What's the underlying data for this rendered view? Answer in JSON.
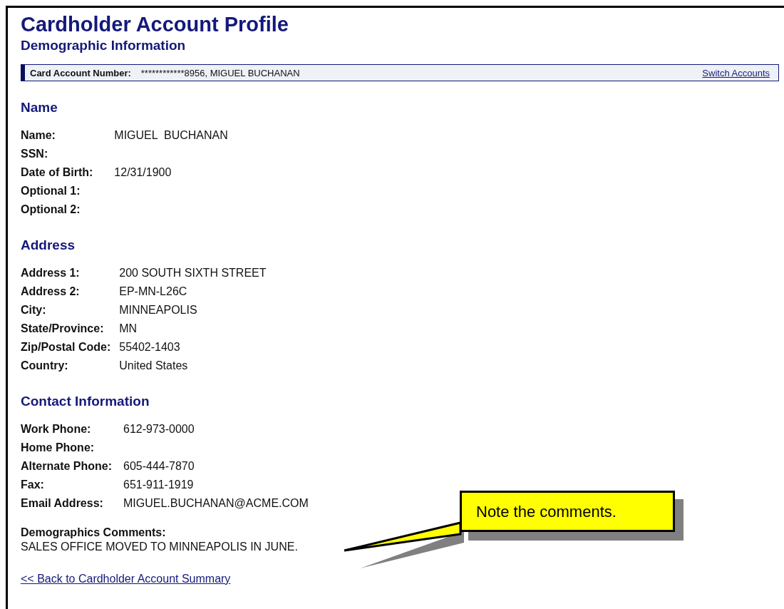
{
  "title": "Cardholder Account Profile",
  "subtitle": "Demographic Information",
  "account_bar": {
    "label": "Card Account Number:",
    "value": "************8956, MIGUEL BUCHANAN",
    "link": "Switch Accounts"
  },
  "sections": [
    {
      "heading": "Name",
      "fields": [
        {
          "label": "Name:",
          "value": "MIGUEL  BUCHANAN"
        },
        {
          "label": "SSN:"
        },
        {
          "label": "Date of Birth:",
          "value": "12/31/1900"
        },
        {
          "label": "Optional 1:"
        },
        {
          "label": "Optional 2:"
        }
      ]
    },
    {
      "heading": "Address",
      "fields": [
        {
          "label": "Address 1:",
          "value": "200 SOUTH SIXTH STREET"
        },
        {
          "label": "Address 2:",
          "value": "EP-MN-L26C"
        },
        {
          "label": "City:",
          "value": "MINNEAPOLIS"
        },
        {
          "label": "State/Province:",
          "value": "MN"
        },
        {
          "label": "Zip/Postal Code:",
          "value": "55402-1403"
        },
        {
          "label": "Country:",
          "value": "United States"
        }
      ]
    },
    {
      "heading": "Contact Information",
      "fields": [
        {
          "label": "Work Phone:",
          "value": "612-973-0000"
        },
        {
          "label": "Home Phone:"
        },
        {
          "label": "Alternate Phone:",
          "value": "605-444-7870"
        },
        {
          "label": "Fax:",
          "value": "651-911-1919"
        },
        {
          "label": "Email Address:",
          "value": "MIGUEL.BUCHANAN@ACME.COM"
        }
      ]
    }
  ],
  "comments": {
    "label": "Demographics Comments:",
    "text": "SALES OFFICE MOVED TO MINNEAPOLIS IN JUNE."
  },
  "back_link": "<< Back to Cardholder Account Summary",
  "callout": {
    "text": "Note the comments."
  }
}
